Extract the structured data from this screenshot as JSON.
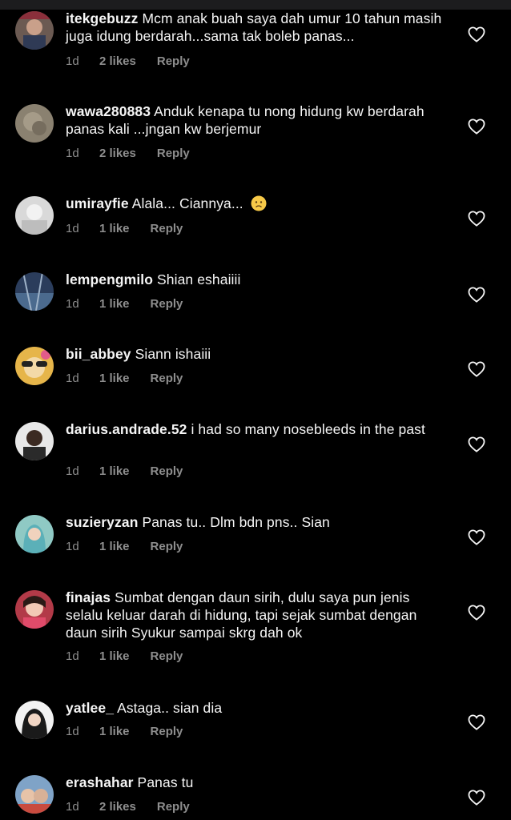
{
  "comments": [
    {
      "username": "itekgebuzz",
      "text": "Mcm anak buah saya dah umur 10 tahun masih juga idung berdarah...sama tak boleb panas...",
      "time": "1d",
      "likes": "2 likes",
      "reply": "Reply"
    },
    {
      "username": "wawa280883",
      "text": "Anduk kenapa tu nong hidung kw berdarah panas kali ...jngan kw berjemur",
      "time": "1d",
      "likes": "2 likes",
      "reply": "Reply"
    },
    {
      "username": "umirayfie",
      "text": "Alala... Ciannya...",
      "emoji": "worried-face-emoji",
      "time": "1d",
      "likes": "1 like",
      "reply": "Reply"
    },
    {
      "username": "lempengmilo",
      "text": "Shian eshaiiii",
      "time": "1d",
      "likes": "1 like",
      "reply": "Reply"
    },
    {
      "username": "bii_abbey",
      "text": "Siann ishaiii",
      "time": "1d",
      "likes": "1 like",
      "reply": "Reply"
    },
    {
      "username": "darius.andrade.52",
      "text": "i had so many nosebleeds in the past",
      "time": "1d",
      "likes": "1 like",
      "reply": "Reply"
    },
    {
      "username": "suzieryzan",
      "text": "Panas tu.. Dlm bdn pns.. Sian",
      "time": "1d",
      "likes": "1 like",
      "reply": "Reply"
    },
    {
      "username": "finajas",
      "text": "Sumbat dengan daun sirih, dulu saya pun jenis selalu keluar darah di hidung, tapi sejak sumbat dengan daun sirih Syukur sampai skrg dah ok",
      "time": "1d",
      "likes": "1 like",
      "reply": "Reply"
    },
    {
      "username": "yatlee_",
      "text": "Astaga.. sian dia",
      "time": "1d",
      "likes": "1 like",
      "reply": "Reply"
    },
    {
      "username": "erashahar",
      "text": "Panas tu",
      "time": "1d",
      "likes": "2 likes",
      "reply": "Reply"
    }
  ],
  "icons": {
    "like": "heart-outline-icon"
  },
  "colors": {
    "background": "#000000",
    "text": "#f5f5f5",
    "meta": "#8e8e8e"
  }
}
